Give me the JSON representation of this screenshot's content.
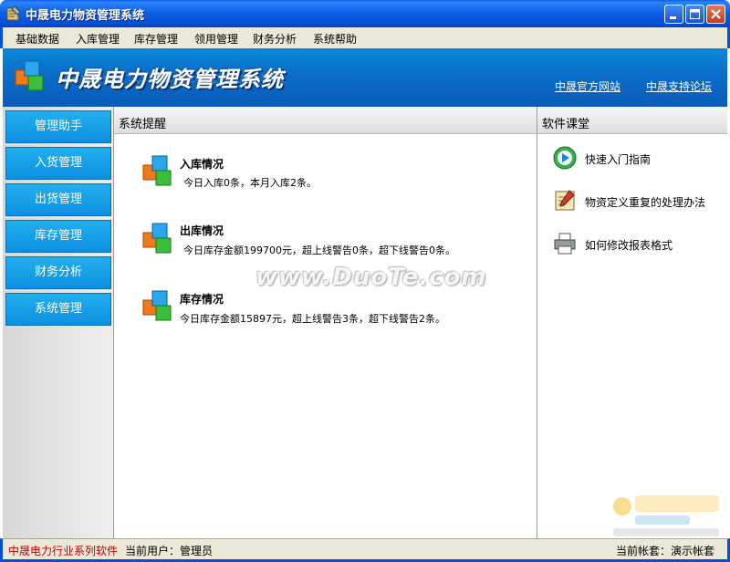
{
  "window": {
    "title": "中晟电力物资管理系统"
  },
  "menu": {
    "items": [
      "基础数据",
      "入库管理",
      "库存管理",
      "领用管理",
      "财务分析",
      "系统帮助"
    ]
  },
  "banner": {
    "title": "中晟电力物资管理系统",
    "links": [
      "中晟官方网站",
      "中晟支持论坛"
    ]
  },
  "nav": {
    "items": [
      "管理助手",
      "入货管理",
      "出货管理",
      "库存管理",
      "财务分析",
      "系统管理"
    ]
  },
  "reminders": {
    "header": "系统提醒",
    "items": [
      {
        "title": "入库情况",
        "text": "今日入库0条，本月入库2条。"
      },
      {
        "title": "出库情况",
        "text": "今日库存金额199700元，超上线警告0条，超下线警告0条。"
      },
      {
        "title": "库存情况",
        "text": "今日库存金额15897元，超上线警告3条，超下线警告2条。"
      }
    ]
  },
  "watermark": "www.DuoTe.com",
  "course": {
    "header": "软件课堂",
    "items": [
      {
        "label": "快速入门指南",
        "icon": "play-icon"
      },
      {
        "label": "物资定义重复的处理办法",
        "icon": "edit-document-icon"
      },
      {
        "label": "如何修改报表格式",
        "icon": "printer-icon"
      }
    ]
  },
  "statusbar": {
    "series": "中晟电力行业系列软件",
    "user_label": "当前用户：管理员",
    "account_label": "当前帐套：演示帐套"
  },
  "colors": {
    "accent": "#0c8fe0",
    "banner": "#0a6fcb",
    "series_text": "#c00000"
  }
}
